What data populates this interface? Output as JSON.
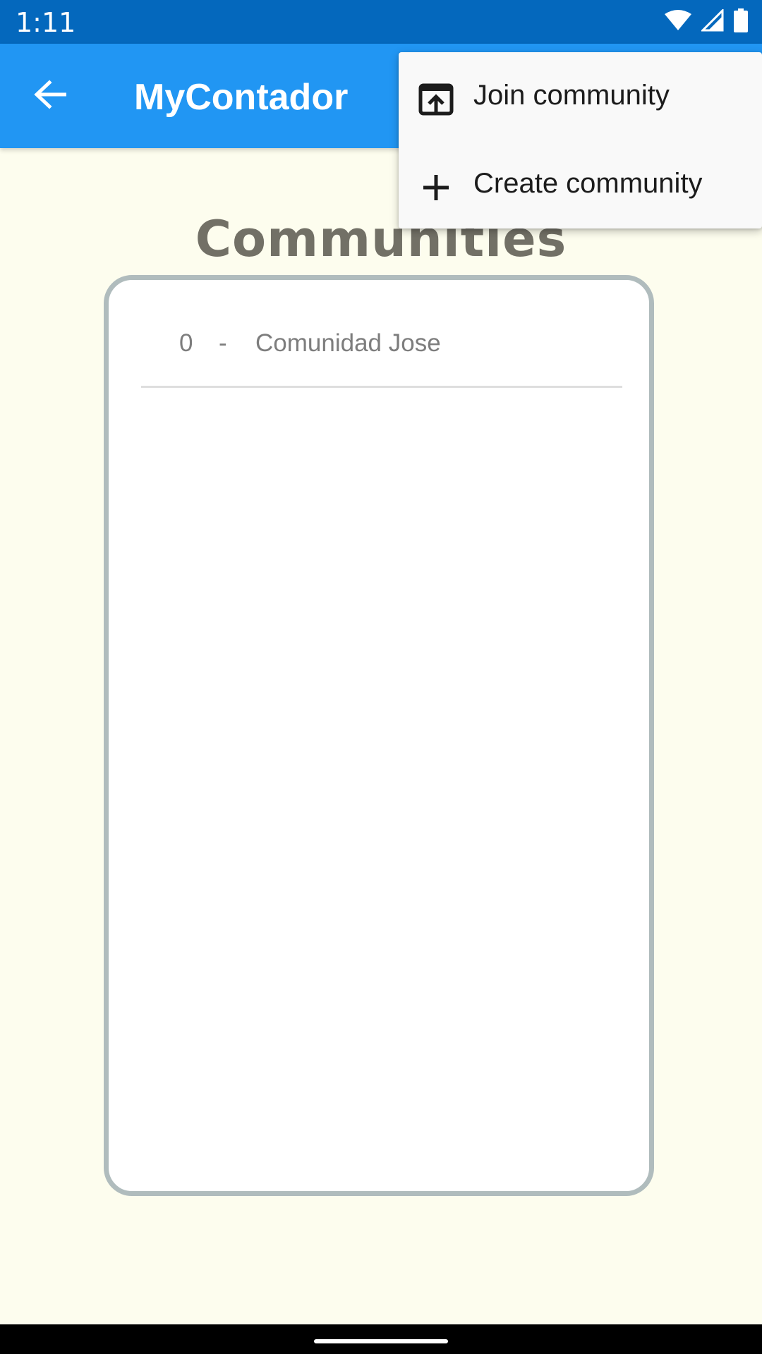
{
  "status_bar": {
    "time": "1:11",
    "icons": [
      "wifi-icon",
      "cell-signal-icon",
      "battery-icon"
    ]
  },
  "app_bar": {
    "back_icon": "arrow-back-icon",
    "title": "MyContador",
    "background": "#2196f3"
  },
  "content": {
    "heading": "Communities",
    "communities": [
      {
        "id": "0",
        "separator": "-",
        "name": "Comunidad Jose"
      }
    ]
  },
  "menu": {
    "items": [
      {
        "icon": "open-in-browser-icon",
        "label": "Join community"
      },
      {
        "icon": "plus-icon",
        "label": "Create community"
      }
    ]
  },
  "colors": {
    "status_bar": "#0468bd",
    "background": "#fdfdee",
    "card_border": "#b0bcbd",
    "heading": "#727066"
  }
}
